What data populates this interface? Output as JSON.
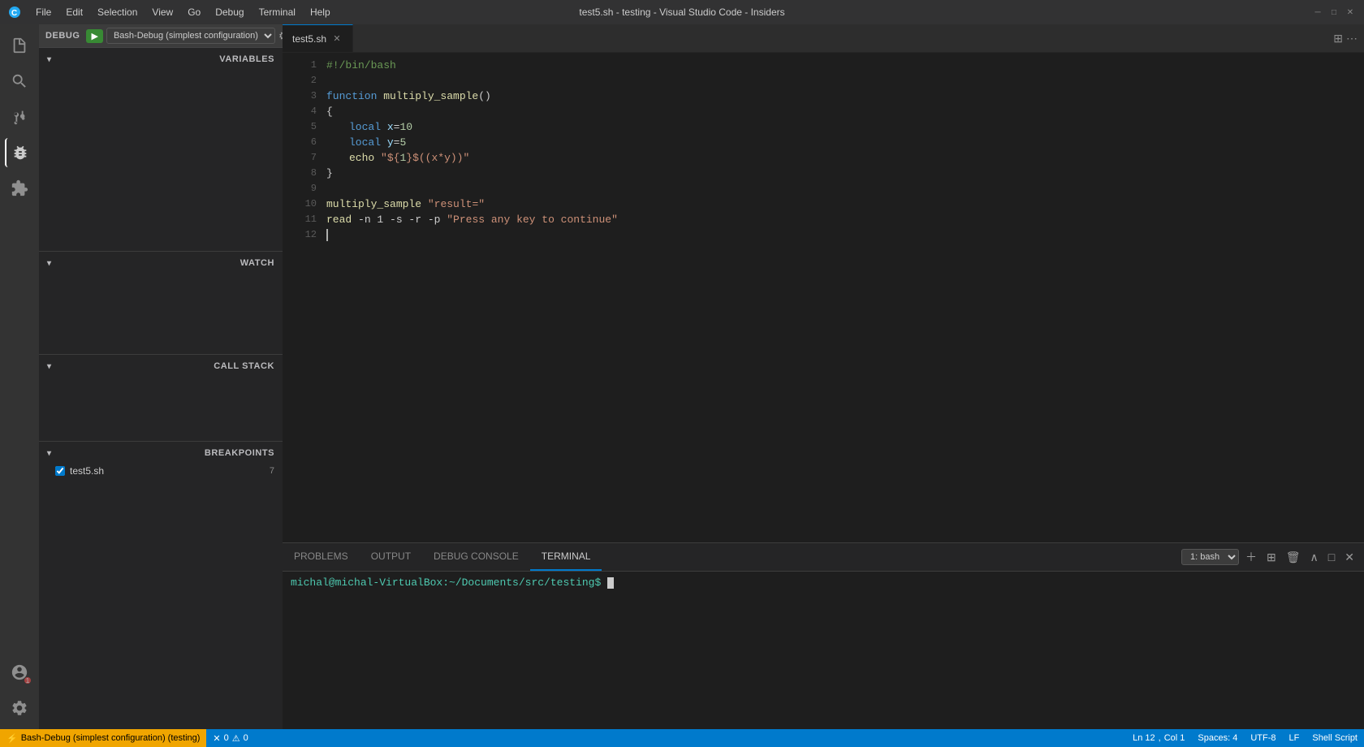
{
  "titleBar": {
    "title": "test5.sh - testing - Visual Studio Code - Insiders",
    "menuItems": [
      "File",
      "Edit",
      "Selection",
      "View",
      "Go",
      "Debug",
      "Terminal",
      "Help"
    ]
  },
  "activityBar": {
    "icons": [
      {
        "name": "explorer-icon",
        "symbol": "📄"
      },
      {
        "name": "search-icon",
        "symbol": "🔍"
      },
      {
        "name": "source-control-icon",
        "symbol": "⑂"
      },
      {
        "name": "debug-icon",
        "symbol": "🐛"
      },
      {
        "name": "extensions-icon",
        "symbol": "⊞"
      }
    ],
    "bottomIcons": [
      {
        "name": "account-icon",
        "symbol": "⚙"
      },
      {
        "name": "settings-icon",
        "symbol": "⚙"
      }
    ]
  },
  "sidebar": {
    "debugLabel": "DEBUG",
    "debugConfig": "Bash-Debug (simplest configuration)",
    "sections": {
      "variables": "VARIABLES",
      "watch": "WATCH",
      "callStack": "CALL STACK",
      "breakpoints": "BREAKPOINTS"
    },
    "breakpoints": [
      {
        "file": "test5.sh",
        "line": "7",
        "enabled": true
      }
    ]
  },
  "editor": {
    "tab": {
      "filename": "test5.sh",
      "icon": "sh-icon"
    },
    "lines": [
      {
        "num": 1,
        "content": "#!/bin/bash"
      },
      {
        "num": 2,
        "content": ""
      },
      {
        "num": 3,
        "content": "function multiply_sample()"
      },
      {
        "num": 4,
        "content": "{"
      },
      {
        "num": 5,
        "content": "    local x=10"
      },
      {
        "num": 6,
        "content": "    local y=5"
      },
      {
        "num": 7,
        "content": "    echo \"${1}$((x*y))\""
      },
      {
        "num": 8,
        "content": "}"
      },
      {
        "num": 9,
        "content": ""
      },
      {
        "num": 10,
        "content": "multiply_sample \"result=\""
      },
      {
        "num": 11,
        "content": "read -n 1 -s -r -p \"Press any key to continue\""
      },
      {
        "num": 12,
        "content": ""
      }
    ],
    "cursorLine": 12,
    "cursorCol": 1
  },
  "terminal": {
    "tabs": [
      "PROBLEMS",
      "OUTPUT",
      "DEBUG CONSOLE",
      "TERMINAL"
    ],
    "activeTab": "TERMINAL",
    "shellSelect": "1: bash",
    "prompt": "michal@michal-VirtualBox:~/Documents/src/testing$",
    "input": ""
  },
  "statusBar": {
    "debugStatus": "⚡ Bash-Debug (simplest configuration) (testing)",
    "errors": "0",
    "warnings": "0",
    "line": "Ln 12",
    "col": "Col 1",
    "spaces": "Spaces: 4",
    "encoding": "UTF-8",
    "lineEnding": "LF",
    "language": "Shell Script"
  }
}
